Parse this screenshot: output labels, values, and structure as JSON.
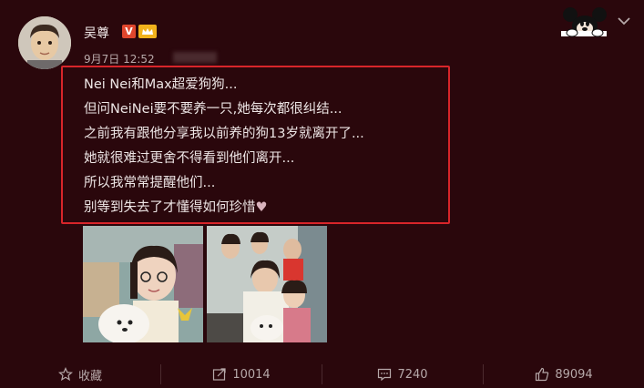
{
  "post": {
    "username": "吴尊",
    "verified_badge": "V",
    "date": "9月7日 12:52",
    "lines": [
      "Nei Nei和Max超爱狗狗...",
      "但问NeiNei要不要养一只,她每次都很纠结...",
      "之前我有跟他分享我以前养的狗13岁就离开了...",
      "她就很难过更舍不得看到他们离开...",
      "所以我常常提醒他们...",
      "别等到失去了才懂得如何珍惜"
    ],
    "end_emoji": "♥"
  },
  "actions": {
    "favorite": "收藏",
    "repost_count": "10014",
    "comment_count": "7240",
    "like_count": "89094"
  },
  "colors": {
    "background": "#2a070c",
    "highlight_box": "#d8252a",
    "badge": "#e0462d"
  },
  "icons": [
    "star-icon",
    "repost-icon",
    "comment-icon",
    "thumbs-up-icon",
    "chevron-down-icon",
    "mickey-icon",
    "crown-icon"
  ]
}
